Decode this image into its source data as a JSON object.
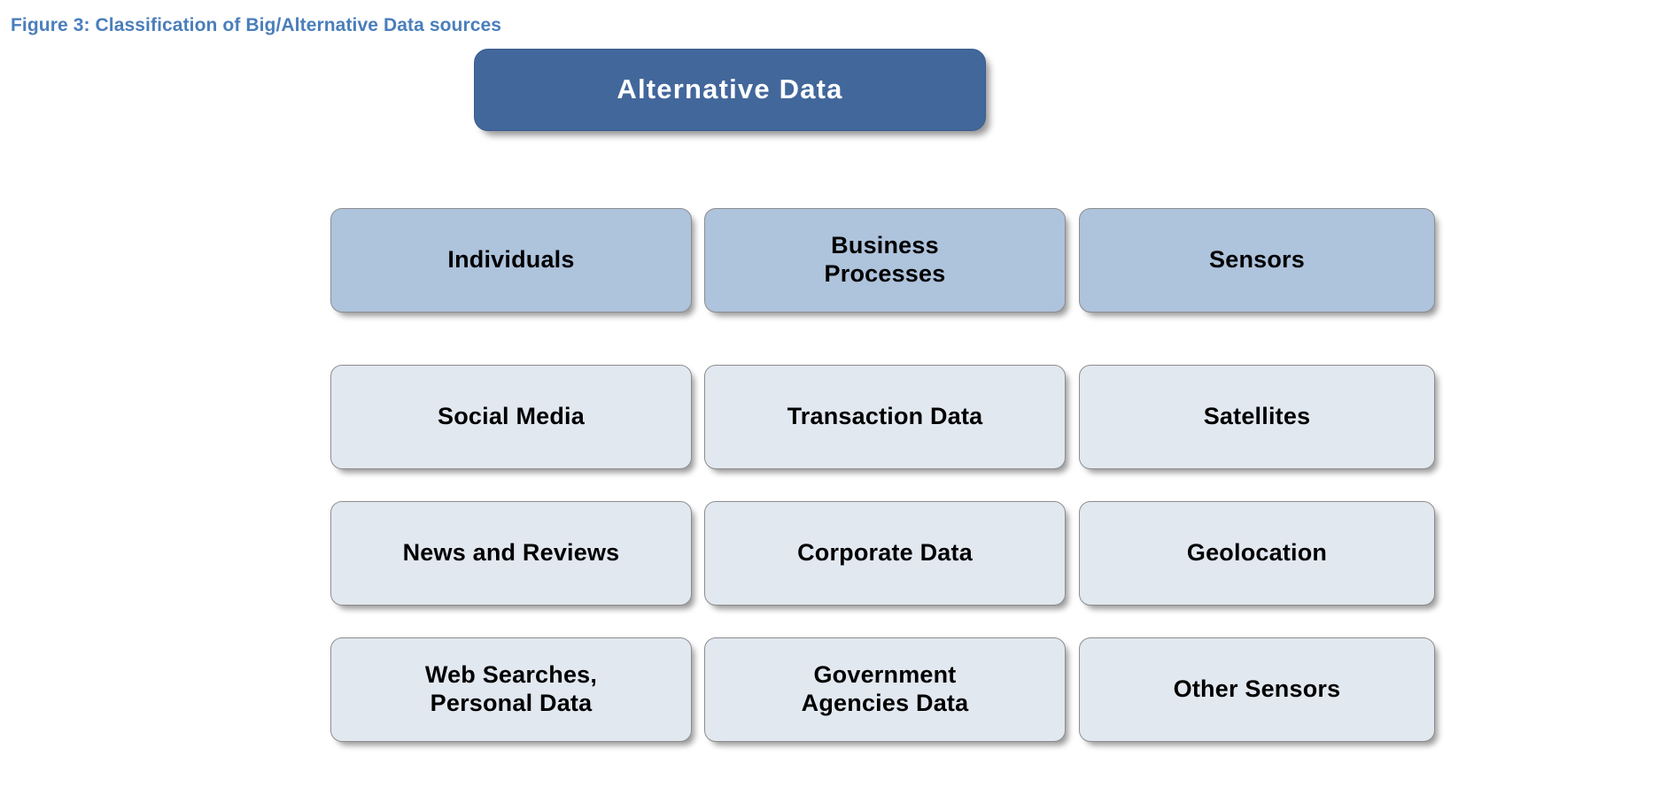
{
  "figure": {
    "title": "Figure 3: Classification of Big/Alternative Data sources",
    "title_color": "#4A7EBB",
    "background_color": "#FFFFFF"
  },
  "diagram": {
    "type": "hierarchy-grid",
    "root": {
      "label": "Alternative Data",
      "fill_color": "#42679B",
      "text_color": "#FFFFFF"
    },
    "category_fill_color": "#AEC3DC",
    "leaf_fill_color": "#E2E8F0",
    "border_color": "#8D8D8D",
    "columns": [
      {
        "category": "Individuals",
        "items": [
          "Social Media",
          "News and Reviews",
          "Web Searches,\nPersonal Data"
        ]
      },
      {
        "category": "Business\nProcesses",
        "items": [
          "Transaction Data",
          "Corporate Data",
          "Government\nAgencies Data"
        ]
      },
      {
        "category": "Sensors",
        "items": [
          "Satellites",
          "Geolocation",
          "Other Sensors"
        ]
      }
    ]
  }
}
